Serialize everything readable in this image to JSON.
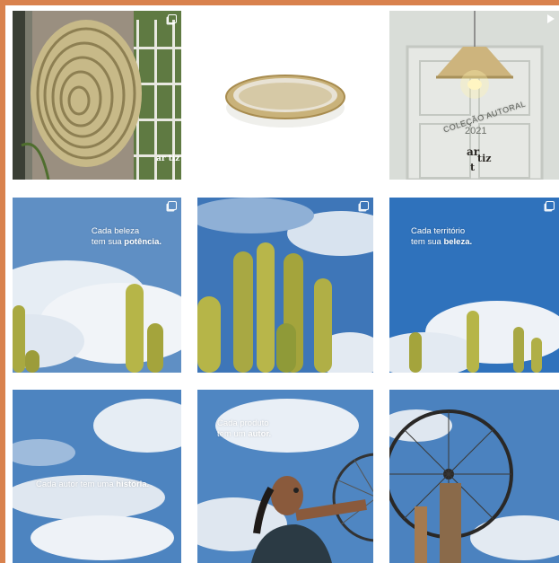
{
  "feed": {
    "posts": [
      {
        "id": "p1",
        "type": "carousel",
        "subject": "woven-spiral-wall-art",
        "tag": "ar tiz"
      },
      {
        "id": "p2",
        "type": "image",
        "subject": "woven-tray"
      },
      {
        "id": "p3",
        "type": "video",
        "subject": "woven-pendant-lamp",
        "collection_line1": "COLEÇÃO AUTORAL",
        "collection_year": "2021",
        "brand_top": "ar",
        "brand_mid": "tiz",
        "brand_bottom": "t"
      },
      {
        "id": "p4",
        "type": "carousel",
        "subject": "cactus-sky",
        "caption_line1": "Cada beleza",
        "caption_line2_pre": "tem sua ",
        "caption_line2_bold": "potência."
      },
      {
        "id": "p5",
        "type": "carousel",
        "subject": "cactus-sky-closeup"
      },
      {
        "id": "p6",
        "type": "carousel",
        "subject": "cactus-sky",
        "caption_line1": "Cada território",
        "caption_line2_pre": "tem sua ",
        "caption_line2_bold": "beleza."
      },
      {
        "id": "p7",
        "type": "image",
        "subject": "sky-clouds",
        "caption_pre": "Cada autor tem uma ",
        "caption_bold": "história."
      },
      {
        "id": "p8",
        "type": "image",
        "subject": "woman-with-wheel",
        "caption_line1": "Cada produto",
        "caption_line2_pre": "tem um ",
        "caption_line2_bold": "autor."
      },
      {
        "id": "p9",
        "type": "image",
        "subject": "bicycle-wheel-sky"
      }
    ]
  },
  "colors": {
    "frame": "#d9824e",
    "sky": "#3b7fc2",
    "cactus": "#b6b548",
    "straw": "#c8b27a"
  }
}
